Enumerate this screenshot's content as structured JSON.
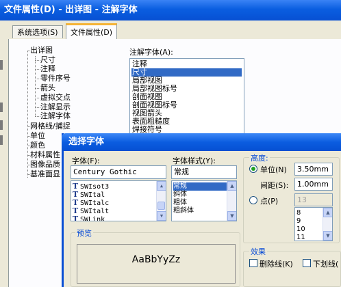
{
  "window": {
    "title": "文件属性(D) - 出详图 - 注解字体"
  },
  "tabs": [
    {
      "label": "系统选项(S)",
      "active": false
    },
    {
      "label": "文件属性(D)",
      "active": true
    }
  ],
  "tree": {
    "root": "出详图",
    "children": [
      "尺寸",
      "注释",
      "零件序号",
      "箭头",
      "虚拟交点",
      "注解显示",
      "注解字体"
    ],
    "siblings": [
      "网格线/捕捉",
      "单位",
      "颜色",
      "材料属性",
      "图像品质",
      "基准面显"
    ]
  },
  "annotation_font": {
    "label": "注解字体(A):",
    "items": [
      "注释",
      "尺寸",
      "局部视图",
      "局部视图标号",
      "剖面视图",
      "剖面视图标号",
      "视图箭头",
      "表面粗糙度",
      "焊接符号"
    ],
    "selected": "尺寸"
  },
  "font_dialog": {
    "title": "选择字体",
    "font_label": "字体(F):",
    "font_value": "Century Gothic",
    "font_list": [
      "SWIsot3",
      "SWItal",
      "SWItalc",
      "SWItalt",
      "SWLink"
    ],
    "style_label": "字体样式(Y):",
    "style_value": "常规",
    "style_list": [
      "常规",
      "斜体",
      "粗体",
      "粗斜体"
    ],
    "style_selected": "常规",
    "height_group": "高度:",
    "unit_radio": "单位(N)",
    "unit_value": "3.50mm",
    "spacing_label": "间距(S):",
    "spacing_value": "1.00mm",
    "point_radio": "点(P)",
    "point_value": "13",
    "point_list": [
      "8",
      "9",
      "10",
      "11"
    ],
    "preview_group": "预览",
    "preview_text": "AaBbYyZz",
    "effects_group": "效果",
    "strikeout_label": "删除线(K)",
    "underline_label": "下划线("
  },
  "colors": {
    "titlebar": "#0a5ee0",
    "selection": "#316ac5",
    "group_label": "#0046d5"
  }
}
